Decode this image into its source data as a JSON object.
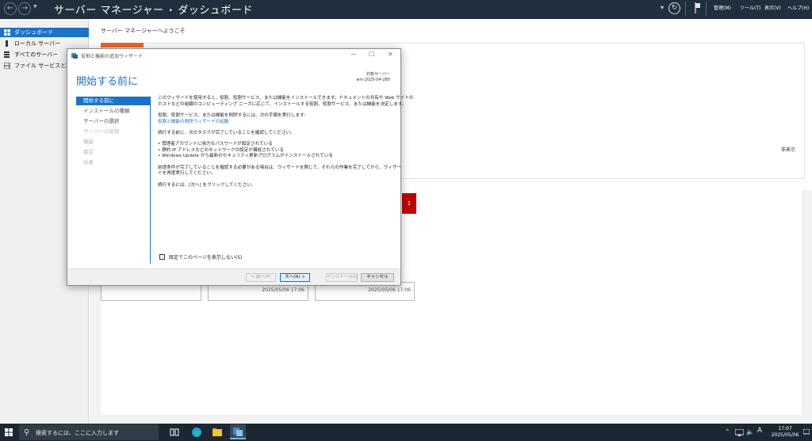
{
  "header": {
    "app_name": "サーバー マネージャー",
    "separator": "•",
    "page": "ダッシュボード",
    "menus": [
      "管理(M)",
      "ツール(T)",
      "表示(V)",
      "ヘルプ(H)"
    ]
  },
  "sidebar": {
    "items": [
      {
        "label": "ダッシュボード"
      },
      {
        "label": "ローカル サーバー"
      },
      {
        "label": "すべてのサーバー"
      },
      {
        "label": "ファイル サービスと記憶域サービス"
      }
    ]
  },
  "dashboard": {
    "welcome_title": "サーバー マネージャーへようこそ",
    "hide_label": "非表示",
    "badge_count": "1",
    "tile_timestamps": [
      "2025/05/06 17:06",
      "2025/05/06 17:06"
    ]
  },
  "wizard": {
    "window_title": "役割と機能の追加ウィザード",
    "heading": "開始する前に",
    "dest_label": "対象サーバー",
    "dest_server": "win-2025-04-280",
    "steps": [
      {
        "label": "開始する前に",
        "state": "active"
      },
      {
        "label": "インストールの種類",
        "state": "enabled"
      },
      {
        "label": "サーバーの選択",
        "state": "enabled"
      },
      {
        "label": "サーバーの役割",
        "state": "disabled"
      },
      {
        "label": "機能",
        "state": "disabled"
      },
      {
        "label": "確認",
        "state": "disabled"
      },
      {
        "label": "結果",
        "state": "disabled"
      }
    ],
    "body": {
      "intro_1": "このウィザードを使用すると、役割、役割サービス、または機能をインストールできます。ドキュメントの共有や Web サイトの",
      "intro_2": "ホストなどの組織のコンピューティング ニーズに応じて、インストールする役割、役割サービス、または機能を決定します。",
      "remove_1": "役割、役割サービス、または機能を削除するには、次の手順を実行します:",
      "remove_link": "役割と機能の削除ウィザードの起動",
      "verify": "続行する前に、次のタスクが完了していることを確認してください。",
      "bullets": [
        "• 管理者アカウントに強力なパスワードが設定されている",
        "• 静的 IP アドレスなどのネットワークの設定が構成されている",
        "• Windows Update から最新のセキュリティ更新プログラムがインストールされている"
      ],
      "prereq_1": "前提条件が完了していることを確認する必要がある場合は、ウィザードを閉じて、それらの作業を完了してから、ウィザー",
      "prereq_2": "ドを再度実行してください。",
      "continue": "続行するには、[次へ] をクリックしてください。"
    },
    "skip_checkbox_label": "既定でこのページを表示しない(S)",
    "buttons": {
      "prev": "< 前へ(P)",
      "next": "次へ(N) >",
      "install": "インストール(I)",
      "cancel": "キャンセル"
    }
  },
  "taskbar": {
    "search_placeholder": "検索するには、ここに入力します",
    "ime": "A",
    "time": "17:07",
    "date": "2025/05/06"
  },
  "colors": {
    "accent": "#1c73c5",
    "titlebar": "#1f2f3e",
    "orange": "#e8682e",
    "alert_red": "#c00000"
  }
}
